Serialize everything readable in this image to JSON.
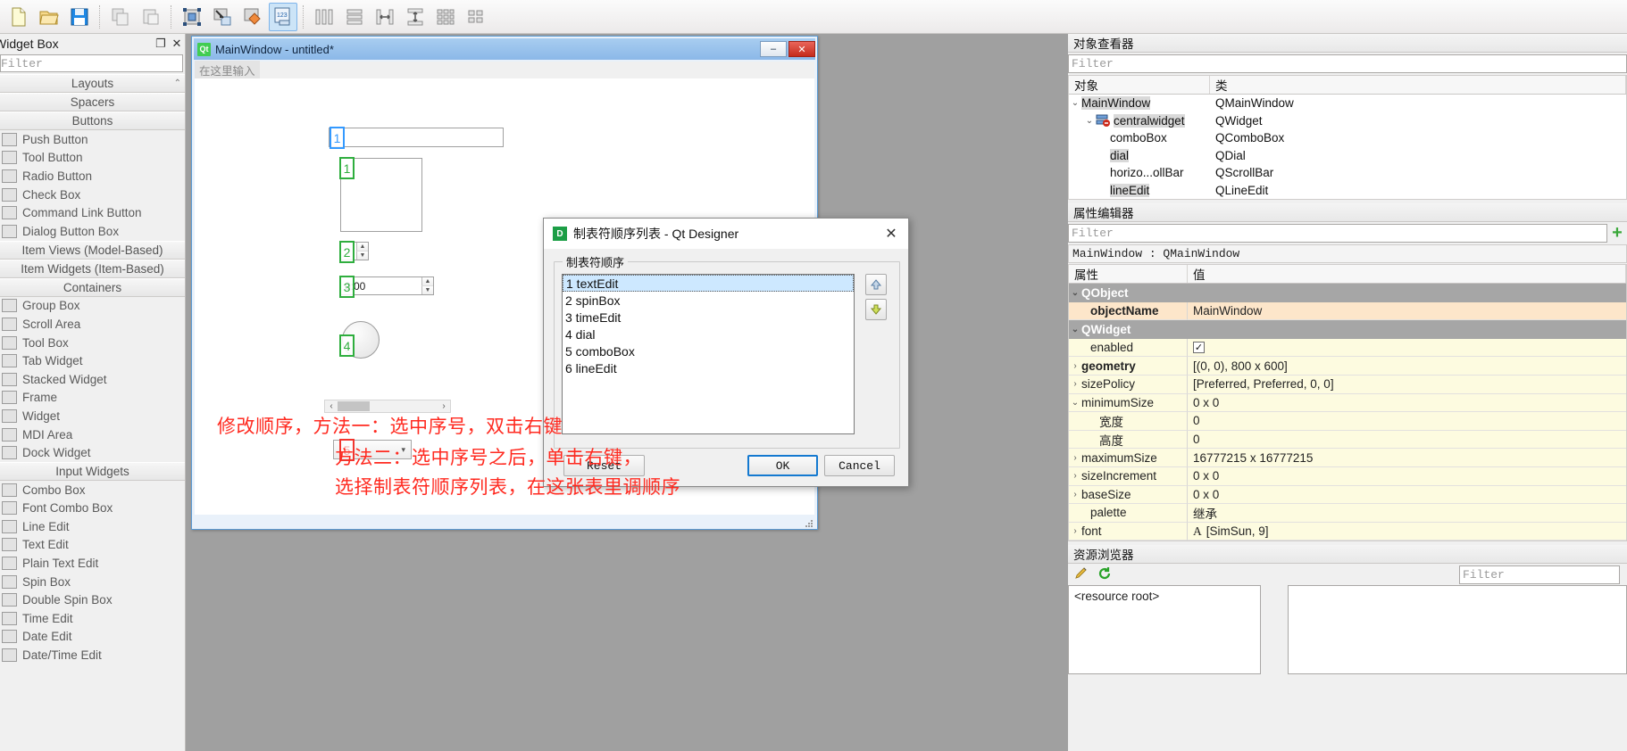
{
  "toolbar": {
    "buttons": [
      {
        "name": "new-file-icon",
        "label": "New"
      },
      {
        "name": "open-file-icon",
        "label": "Open"
      },
      {
        "name": "save-file-icon",
        "label": "Save"
      },
      {
        "name": "copy-icon",
        "label": "Copy"
      },
      {
        "name": "paste-icon",
        "label": "Paste"
      },
      {
        "name": "edit-widgets-icon",
        "label": "Edit Widgets"
      },
      {
        "name": "edit-signals-slots-icon",
        "label": "Edit Signals/Slots"
      },
      {
        "name": "edit-buddies-icon",
        "label": "Edit Buddies"
      },
      {
        "name": "edit-tab-order-icon",
        "label": "Edit Tab Order"
      },
      {
        "name": "layout-horizontally-icon",
        "label": "Lay Out Horizontally"
      },
      {
        "name": "layout-vertically-icon",
        "label": "Lay Out Vertically"
      },
      {
        "name": "layout-splitter-horizontal-icon",
        "label": "Lay Out Horizontally in Splitter"
      },
      {
        "name": "layout-splitter-vertical-icon",
        "label": "Lay Out Vertically in Splitter"
      },
      {
        "name": "layout-grid-icon",
        "label": "Lay Out in a Grid"
      },
      {
        "name": "layout-form-icon",
        "label": "Lay Out in a Form Layout"
      }
    ],
    "active_index": 8
  },
  "widget_box": {
    "title": "Widget Box",
    "float_label": "❐",
    "close_label": "✕",
    "filter_placeholder": "Filter",
    "sections": [
      {
        "kind": "group",
        "label": "Layouts"
      },
      {
        "kind": "group",
        "label": "Spacers"
      },
      {
        "kind": "group",
        "label": "Buttons"
      },
      {
        "kind": "item",
        "label": "Push Button",
        "icon": "push-button-icon"
      },
      {
        "kind": "item",
        "label": "Tool Button",
        "icon": "tool-button-icon"
      },
      {
        "kind": "item",
        "label": "Radio Button",
        "icon": "radio-button-icon"
      },
      {
        "kind": "item",
        "label": "Check Box",
        "icon": "check-box-icon"
      },
      {
        "kind": "item",
        "label": "Command Link Button",
        "icon": "command-link-button-icon"
      },
      {
        "kind": "item",
        "label": "Dialog Button Box",
        "icon": "dialog-button-box-icon"
      },
      {
        "kind": "group",
        "label": "Item Views (Model-Based)"
      },
      {
        "kind": "group",
        "label": "Item Widgets (Item-Based)"
      },
      {
        "kind": "group",
        "label": "Containers"
      },
      {
        "kind": "item",
        "label": "Group Box",
        "icon": "group-box-icon"
      },
      {
        "kind": "item",
        "label": "Scroll Area",
        "icon": "scroll-area-icon"
      },
      {
        "kind": "item",
        "label": "Tool Box",
        "icon": "tool-box-icon"
      },
      {
        "kind": "item",
        "label": "Tab Widget",
        "icon": "tab-widget-icon"
      },
      {
        "kind": "item",
        "label": "Stacked Widget",
        "icon": "stacked-widget-icon"
      },
      {
        "kind": "item",
        "label": "Frame",
        "icon": "frame-icon"
      },
      {
        "kind": "item",
        "label": "Widget",
        "icon": "widget-icon"
      },
      {
        "kind": "item",
        "label": "MDI Area",
        "icon": "mdi-area-icon"
      },
      {
        "kind": "item",
        "label": "Dock Widget",
        "icon": "dock-widget-icon"
      },
      {
        "kind": "group",
        "label": "Input Widgets"
      },
      {
        "kind": "item",
        "label": "Combo Box",
        "icon": "combo-box-icon"
      },
      {
        "kind": "item",
        "label": "Font Combo Box",
        "icon": "font-combo-box-icon"
      },
      {
        "kind": "item",
        "label": "Line Edit",
        "icon": "line-edit-icon"
      },
      {
        "kind": "item",
        "label": "Text Edit",
        "icon": "text-edit-icon"
      },
      {
        "kind": "item",
        "label": "Plain Text Edit",
        "icon": "plain-text-edit-icon"
      },
      {
        "kind": "item",
        "label": "Spin Box",
        "icon": "spin-box-icon"
      },
      {
        "kind": "item",
        "label": "Double Spin Box",
        "icon": "double-spin-box-icon"
      },
      {
        "kind": "item",
        "label": "Time Edit",
        "icon": "time-edit-icon"
      },
      {
        "kind": "item",
        "label": "Date Edit",
        "icon": "date-edit-icon"
      },
      {
        "kind": "item",
        "label": "Date/Time Edit",
        "icon": "date-time-edit-icon"
      }
    ]
  },
  "form": {
    "title": "MainWindow - untitled*",
    "logo": "Qt",
    "minimize_label": "–",
    "maximize_label": "□",
    "close_label": "✕",
    "menubar_placeholder": "在这里输入",
    "time_value": "0:00",
    "tab_badges": [
      {
        "number": "1",
        "color": "blue"
      },
      {
        "number": "1",
        "color": "green"
      },
      {
        "number": "2",
        "color": "green"
      },
      {
        "number": "3",
        "color": "green"
      },
      {
        "number": "4",
        "color": "green"
      },
      {
        "number": "5",
        "color": "red"
      }
    ]
  },
  "dialog": {
    "title": "制表符顺序列表 - Qt Designer",
    "icon_label": "D",
    "close_label": "✕",
    "group_title": "制表符顺序",
    "items": [
      "1 textEdit",
      "2 spinBox",
      "3 timeEdit",
      "4 dial",
      "5 comboBox",
      "6 lineEdit"
    ],
    "selected_index": 0,
    "move_up_label": "▲",
    "move_down_label": "▼",
    "reset_label": "Reset",
    "ok_label": "OK",
    "cancel_label": "Cancel"
  },
  "annotations": [
    "修改顺序，方法一：选中序号，双击右键",
    "方法二：选中序号之后，单击右键，",
    "选择制表符顺序列表，在这张表里调顺序"
  ],
  "object_inspector": {
    "title": "对象查看器",
    "filter_placeholder": "Filter",
    "col_object": "对象",
    "col_class": "类",
    "rows": [
      {
        "indent": 0,
        "chevron": "⌄",
        "name": "MainWindow",
        "class": "QMainWindow",
        "highlight": true
      },
      {
        "indent": 1,
        "chevron": "⌄",
        "name": "centralwidget",
        "class": "QWidget",
        "highlight": true,
        "icon": "central-widget-icon"
      },
      {
        "indent": 2,
        "chevron": "",
        "name": "comboBox",
        "class": "QComboBox",
        "highlight": false
      },
      {
        "indent": 2,
        "chevron": "",
        "name": "dial",
        "class": "QDial",
        "highlight": true
      },
      {
        "indent": 2,
        "chevron": "",
        "name": "horizo...ollBar",
        "class": "QScrollBar",
        "highlight": false
      },
      {
        "indent": 2,
        "chevron": "",
        "name": "lineEdit",
        "class": "QLineEdit",
        "highlight": true
      }
    ]
  },
  "property_editor": {
    "title": "属性编辑器",
    "filter_placeholder": "Filter",
    "add_label": "+",
    "object_header": "MainWindow : QMainWindow",
    "col_property": "属性",
    "col_value": "值",
    "rows": [
      {
        "type": "group",
        "chevron": "⌄",
        "name": "QObject",
        "value": ""
      },
      {
        "type": "orange",
        "chevron": "",
        "name": "objectName",
        "value": "MainWindow",
        "bold": true,
        "indent": 1
      },
      {
        "type": "group",
        "chevron": "⌄",
        "name": "QWidget",
        "value": ""
      },
      {
        "type": "yellow",
        "chevron": "",
        "name": "enabled",
        "value": "",
        "checkbox": true,
        "indent": 1
      },
      {
        "type": "yellow",
        "chevron": "›",
        "name": "geometry",
        "value": "[(0, 0), 800 x 600]",
        "bold": true
      },
      {
        "type": "yellow",
        "chevron": "›",
        "name": "sizePolicy",
        "value": "[Preferred, Preferred, 0, 0]"
      },
      {
        "type": "yellow",
        "chevron": "⌄",
        "name": "minimumSize",
        "value": "0 x 0"
      },
      {
        "type": "yellow",
        "chevron": "",
        "name": "宽度",
        "value": "0",
        "indent": 2
      },
      {
        "type": "yellow",
        "chevron": "",
        "name": "高度",
        "value": "0",
        "indent": 2
      },
      {
        "type": "yellow",
        "chevron": "›",
        "name": "maximumSize",
        "value": "16777215 x 16777215"
      },
      {
        "type": "yellow",
        "chevron": "›",
        "name": "sizeIncrement",
        "value": "0 x 0"
      },
      {
        "type": "yellow",
        "chevron": "›",
        "name": "baseSize",
        "value": "0 x 0"
      },
      {
        "type": "yellow",
        "chevron": "",
        "name": "palette",
        "value": "继承",
        "indent": 1
      },
      {
        "type": "yellow",
        "chevron": "›",
        "name": "font",
        "value": "[SimSun, 9]",
        "font_icon": "A"
      }
    ]
  },
  "resource_browser": {
    "title": "资源浏览器",
    "edit_icon": "pencil-icon",
    "reload_icon": "reload-icon",
    "filter_placeholder": "Filter",
    "root_label": "<resource root>"
  }
}
